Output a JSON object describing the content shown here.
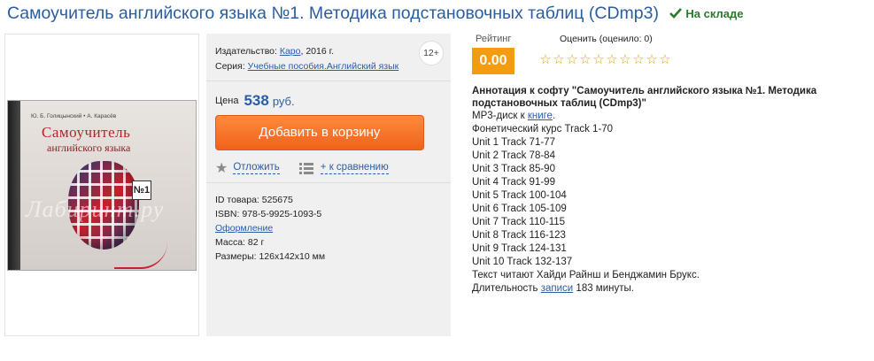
{
  "product": {
    "title": "Самоучитель английского языка №1. Методика подстановочных таблиц (CDmp3)",
    "stock_status": "На складе"
  },
  "cover": {
    "authors": "Ю. Б. Голицынский  •  А. Карасёв",
    "title": "Самоучитель",
    "subtitle": "английского языка",
    "badge": "№1",
    "watermark": "Лабиринт.ру"
  },
  "details": {
    "publisher_label": "Издательство:",
    "publisher": "Каро",
    "year": ", 2016 г.",
    "series_label": "Серия:",
    "series": "Учебные пособия.Английский язык",
    "age": "12+"
  },
  "price": {
    "label": "Цена",
    "value": "538",
    "currency": "руб."
  },
  "actions": {
    "add_to_cart": "Добавить в корзину",
    "postpone": "Отложить",
    "compare": "+ к сравнению"
  },
  "specs": {
    "id": "ID товара: 525675",
    "isbn": "ISBN: 978-5-9925-1093-5",
    "design": "Оформление",
    "mass": "Масса: 82 г",
    "size": "Размеры: 126x142x10 мм"
  },
  "rating": {
    "label": "Рейтинг",
    "value": "0.00",
    "rate_label": "Оценить (оценило: 0)",
    "stars": [
      "☆",
      "☆",
      "☆",
      "☆",
      "☆",
      "☆",
      "☆",
      "☆",
      "☆",
      "☆"
    ]
  },
  "annotation": {
    "title": "Аннотация к софту \"Самоучитель английского языка №1. Методика подстановочных таблиц (CDmp3)\"",
    "intro_prefix": "МР3-диск к ",
    "intro_link": "книге",
    "intro_suffix": ".",
    "tracks": [
      "Фонетический курс Track 1-70",
      "Unit 1 Track 71-77",
      "Unit 2 Track 78-84",
      "Unit 3 Track 85-90",
      "Unit 4 Track 91-99",
      "Unit 5 Track 100-104",
      "Unit 6 Track 105-109",
      "Unit 7 Track 110-115",
      "Unit 8 Track 116-123",
      "Unit 9 Track 124-131",
      "Unit 10 Track 132-137",
      "Текст читают Хайди Райнш и Бенджамин Брукс."
    ],
    "duration_prefix": "Длительность ",
    "duration_link": "записи",
    "duration_suffix": " 183 минуты."
  },
  "colors": {
    "title": "#2a5d9f",
    "in_stock": "#2a7a2a",
    "button": "#f0621a",
    "rating": "#f39c12",
    "link": "#2b5ca6"
  }
}
